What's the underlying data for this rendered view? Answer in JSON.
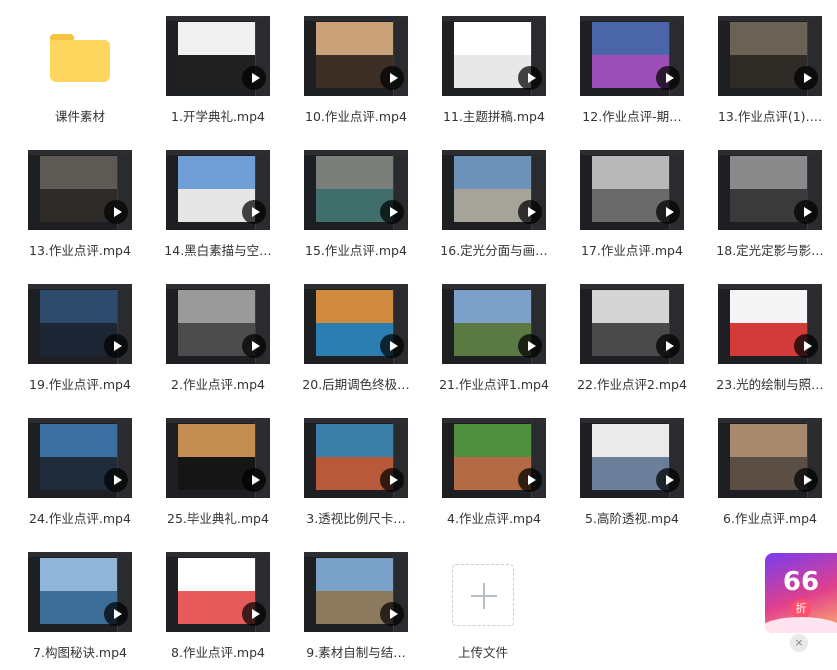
{
  "folder": {
    "label": "课件素材",
    "icon": "folder-icon",
    "color": "#ffd75e"
  },
  "files": [
    {
      "label": "1.开学典礼.mp4",
      "c1": "#f0f0f0",
      "c2": "#202020"
    },
    {
      "label": "10.作业点评.mp4",
      "c1": "#c9a27a",
      "c2": "#3d2f25"
    },
    {
      "label": "11.主题拼稿.mp4",
      "c1": "#ffffff",
      "c2": "#e8e8e8"
    },
    {
      "label": "12.作业点评-期…",
      "c1": "#4a66a8",
      "c2": "#9b4fb6"
    },
    {
      "label": "13.作业点评(1)….",
      "c1": "#6b6255",
      "c2": "#2f2c27"
    },
    {
      "label": "13.作业点评.mp4",
      "c1": "#5d5a55",
      "c2": "#2e2b28"
    },
    {
      "label": "14.黑白素描与空…",
      "c1": "#6f9fd6",
      "c2": "#e6e6e6"
    },
    {
      "label": "15.作业点评.mp4",
      "c1": "#7b7f7a",
      "c2": "#3f6e6b"
    },
    {
      "label": "16.定光分面与画…",
      "c1": "#6d91b7",
      "c2": "#a6a39b"
    },
    {
      "label": "17.作业点评.mp4",
      "c1": "#b8b8b8",
      "c2": "#6a6a6a"
    },
    {
      "label": "18.定光定影与影…",
      "c1": "#8a8a8a",
      "c2": "#3a3a3a"
    },
    {
      "label": "19.作业点评.mp4",
      "c1": "#2f4b6b",
      "c2": "#1c2533"
    },
    {
      "label": "2.作业点评.mp4",
      "c1": "#9a9a9a",
      "c2": "#4c4c4c"
    },
    {
      "label": "20.后期调色终极…",
      "c1": "#d08a3e",
      "c2": "#2b7fb0"
    },
    {
      "label": "21.作业点评1.mp4",
      "c1": "#7da0c9",
      "c2": "#5b7a43"
    },
    {
      "label": "22.作业点评2.mp4",
      "c1": "#d5d5d5",
      "c2": "#4a4a4a"
    },
    {
      "label": "23.光的绘制与照…",
      "c1": "#f5f5f5",
      "c2": "#d33b3b"
    },
    {
      "label": "24.作业点评.mp4",
      "c1": "#3b6fa0",
      "c2": "#1d2b3b"
    },
    {
      "label": "25.毕业典礼.mp4",
      "c1": "#c28d4e",
      "c2": "#151515"
    },
    {
      "label": "3.透视比例尺卡…",
      "c1": "#3c7fa8",
      "c2": "#b85a3a"
    },
    {
      "label": "4.作业点评.mp4",
      "c1": "#4f8f3e",
      "c2": "#b36a45"
    },
    {
      "label": "5.高阶透视.mp4",
      "c1": "#eaeaea",
      "c2": "#6c7f9a"
    },
    {
      "label": "6.作业点评.mp4",
      "c1": "#a78a6d",
      "c2": "#5b4f45"
    },
    {
      "label": "7.构图秘诀.mp4",
      "c1": "#8fb6d8",
      "c2": "#3d6e9a"
    },
    {
      "label": "8.作业点评.mp4",
      "c1": "#ffffff",
      "c2": "#e65a5a"
    },
    {
      "label": "9.素材自制与结…",
      "c1": "#7aa2c8",
      "c2": "#8b7a5e"
    }
  ],
  "upload": {
    "label": "上传文件"
  },
  "promo": {
    "number": "66",
    "unit": "折",
    "close": "×"
  }
}
